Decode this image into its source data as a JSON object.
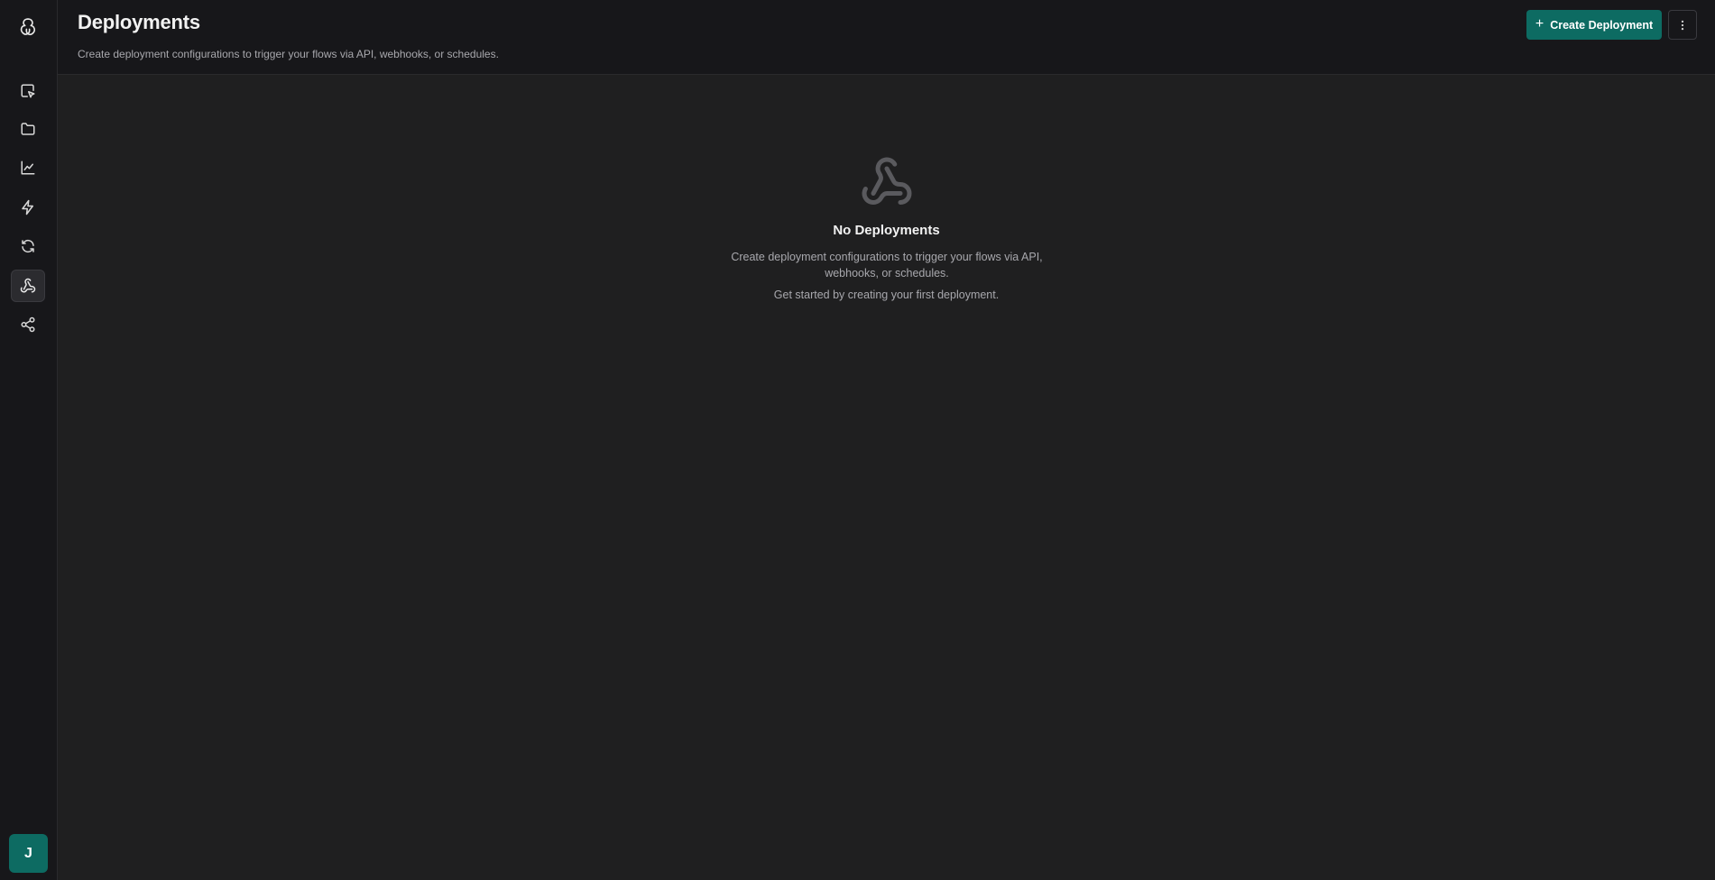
{
  "header": {
    "title": "Deployments",
    "subtitle": "Create deployment configurations to trigger your flows via API, webhooks, or schedules.",
    "create_button_label": "Create Deployment",
    "create_button_icon": "plus-icon",
    "more_button_icon": "more-vertical-icon"
  },
  "sidebar": {
    "logo_icon": "app-logo-icon",
    "items": [
      {
        "icon": "cursor-box-icon",
        "active": false
      },
      {
        "icon": "folder-icon",
        "active": false
      },
      {
        "icon": "line-chart-icon",
        "active": false
      },
      {
        "icon": "lightning-icon",
        "active": false
      },
      {
        "icon": "refresh-icon",
        "active": false
      },
      {
        "icon": "webhook-icon",
        "active": true
      },
      {
        "icon": "share-icon",
        "active": false
      }
    ],
    "avatar_initial": "J"
  },
  "empty_state": {
    "icon": "webhook-icon",
    "title": "No Deployments",
    "description": "Create deployment configurations to trigger your flows via API, webhooks, or schedules.",
    "hint": "Get started by creating your first deployment."
  },
  "colors": {
    "accent": "#0d6b62",
    "background": "#1f1f20",
    "sidebar_background": "#17171a"
  }
}
